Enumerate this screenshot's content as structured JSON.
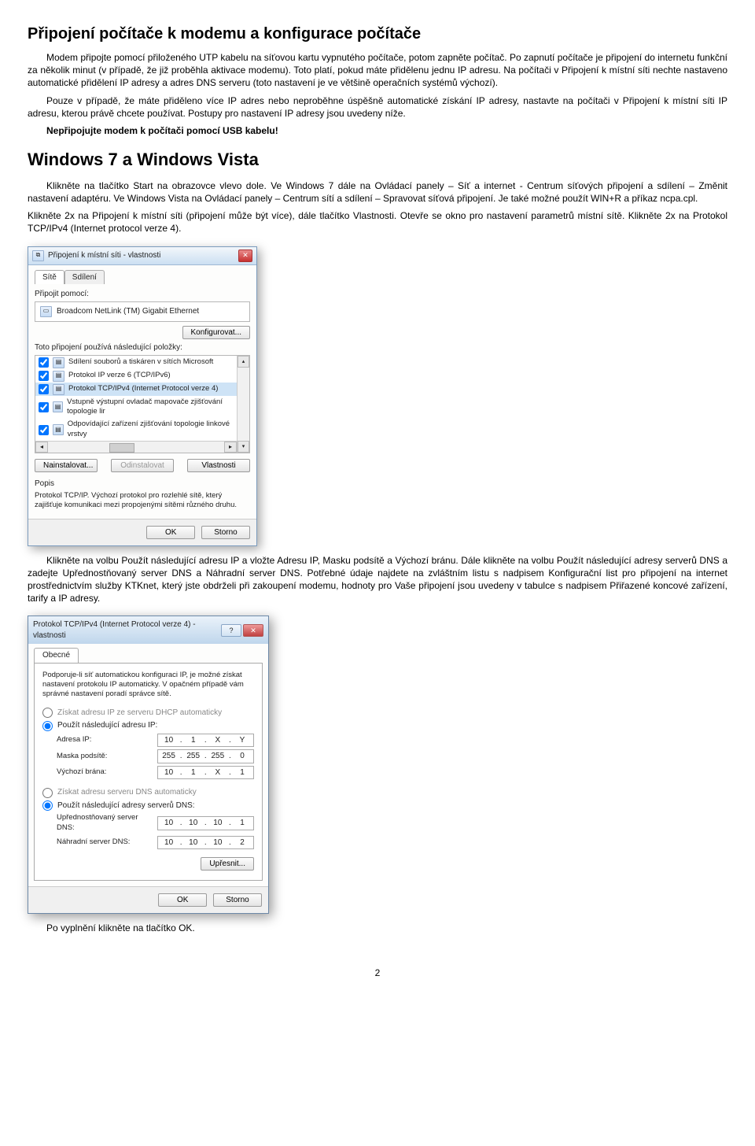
{
  "h1": "Připojení počítače k modemu a konfigurace počítače",
  "p1": "Modem připojte pomocí přiloženého UTP kabelu na síťovou kartu vypnutého počítače, potom zapněte počítač. Po zapnutí počítače je připojení do internetu funkční za několik minut (v případě, že již proběhla aktivace modemu). Toto platí, pokud máte přidělenu jednu IP adresu. Na počítači v Připojení k místní síti nechte nastaveno automatické přidělení IP adresy a adres DNS serveru (toto nastavení je ve většině operačních systémů výchozí).",
  "p2": "Pouze v případě, že máte přiděleno více IP adres nebo neproběhne úspěšně automatické získání IP adresy, nastavte na počítači v Připojení k místní síti IP adresu, kterou právě chcete používat. Postupy pro nastavení IP adresy jsou uvedeny níže.",
  "p3": "Nepřipojujte modem k počítači pomocí USB kabelu!",
  "h2": "Windows 7 a Windows Vista",
  "p4": "Klikněte na tlačítko Start na obrazovce vlevo dole. Ve Windows 7 dále na Ovládací panely – Síť a internet - Centrum síťových připojení a sdílení – Změnit nastavení adaptéru. Ve Windows Vista na Ovládací panely – Centrum sítí a sdílení – Spravovat síťová připojení. Je také možné použít WIN+R a příkaz ncpa.cpl.",
  "p5": "Klikněte 2x na Připojení k místní síti (připojení může být více), dále tlačítko Vlastnosti. Otevře se okno pro nastavení parametrů místní sítě. Klikněte 2x na Protokol TCP/IPv4 (Internet protocol verze 4).",
  "p6": "Klikněte na volbu Použít následující adresu IP a vložte Adresu IP, Masku podsítě a Výchozí bránu. Dále klikněte na volbu Použít následující adresy serverů DNS a zadejte Upřednostňovaný server DNS a Náhradní server DNS. Potřebné údaje najdete na zvláštním listu s nadpisem Konfigurační list pro připojení na internet prostřednictvím služby KTKnet, který jste obdrželi při zakoupení modemu, hodnoty pro Vaše připojení jsou uvedeny v tabulce s nadpisem Přiřazené koncové zařízení, tarify a IP adresy.",
  "p7": "Po vyplnění klikněte na tlačítko OK.",
  "pagenum": "2",
  "dlg1": {
    "title": "Připojení k místní síti - vlastnosti",
    "tab1": "Sítě",
    "tab2": "Sdílení",
    "connect_using": "Připojit pomocí:",
    "adapter": "Broadcom NetLink (TM) Gigabit Ethernet",
    "configure": "Konfigurovat...",
    "uses_items": "Toto připojení používá následující položky:",
    "items": [
      "Sdílení souborů a tiskáren v sítích Microsoft",
      "Protokol IP verze 6 (TCP/IPv6)",
      "Protokol TCP/IPv4 (Internet Protocol verze 4)",
      "Vstupně výstupní ovladač mapovače zjišťování topologie lir",
      "Odpovídající zařízení zjišťování topologie linkové vrstvy"
    ],
    "btn_install": "Nainstalovat...",
    "btn_uninstall": "Odinstalovat",
    "btn_props": "Vlastnosti",
    "desc_label": "Popis",
    "desc_text": "Protokol TCP/IP. Výchozí protokol pro rozlehlé sítě, který zajišťuje komunikaci mezi propojenými sítěmi různého druhu.",
    "ok": "OK",
    "cancel": "Storno"
  },
  "dlg2": {
    "title": "Protokol TCP/IPv4 (Internet Protocol verze 4) - vlastnosti",
    "tab": "Obecné",
    "intro": "Podporuje-li síť automatickou konfiguraci IP, je možné získat nastavení protokolu IP automaticky. V opačném případě vám správné nastavení poradí správce sítě.",
    "r_auto_ip": "Získat adresu IP ze serveru DHCP automaticky",
    "r_manual_ip": "Použít následující adresu IP:",
    "lbl_ip": "Adresa IP:",
    "lbl_mask": "Maska podsítě:",
    "lbl_gw": "Výchozí brána:",
    "ip": [
      "10",
      "1",
      "X",
      "Y"
    ],
    "mask": [
      "255",
      "255",
      "255",
      "0"
    ],
    "gw": [
      "10",
      "1",
      "X",
      "1"
    ],
    "r_auto_dns": "Získat adresu serveru DNS automaticky",
    "r_manual_dns": "Použít následující adresy serverů DNS:",
    "lbl_dns1": "Upřednostňovaný server DNS:",
    "lbl_dns2": "Náhradní server DNS:",
    "dns1": [
      "10",
      "10",
      "10",
      "1"
    ],
    "dns2": [
      "10",
      "10",
      "10",
      "2"
    ],
    "advanced": "Upřesnit...",
    "ok": "OK",
    "cancel": "Storno"
  }
}
